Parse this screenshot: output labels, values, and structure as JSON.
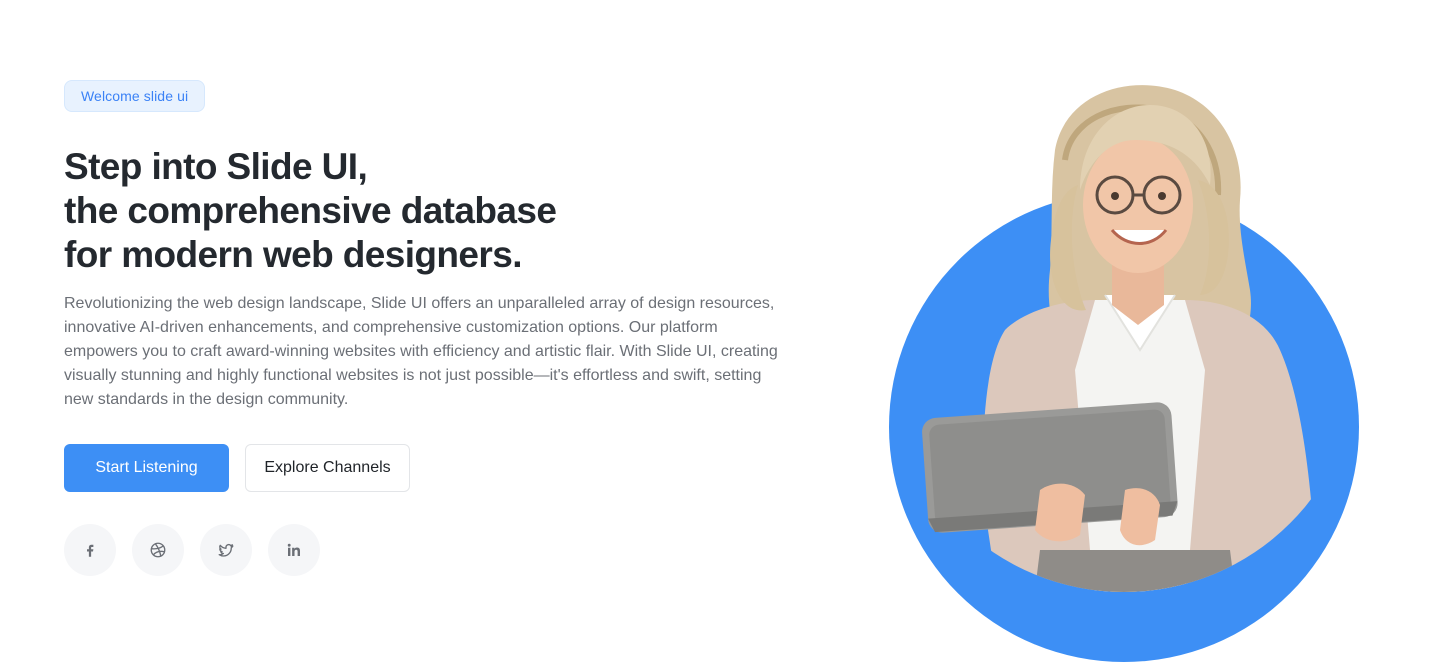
{
  "badge": "Welcome slide ui",
  "headline": {
    "line1": "Step into Slide UI,",
    "line2": "the comprehensive database",
    "line3": "for modern web designers."
  },
  "description": "Revolutionizing the web design landscape, Slide UI offers an unparalleled array of design resources, innovative AI-driven enhancements, and comprehensive customization options. Our platform empowers you to craft award-winning websites with efficiency and artistic flair. With Slide UI, creating visually stunning and highly functional websites is not just possible—it's effortless and swift, setting new standards in the design community.",
  "buttons": {
    "primary": "Start Listening",
    "secondary": "Explore Channels"
  },
  "socials": [
    {
      "icon": "facebook-icon"
    },
    {
      "icon": "dribbble-icon"
    },
    {
      "icon": "twitter-icon"
    },
    {
      "icon": "linkedin-icon"
    }
  ],
  "colors": {
    "accent": "#3d8ff5",
    "badge_bg": "#e8f2fe",
    "badge_text": "#3b82f6",
    "heading": "#24292f",
    "body_text": "#6b6f76"
  }
}
